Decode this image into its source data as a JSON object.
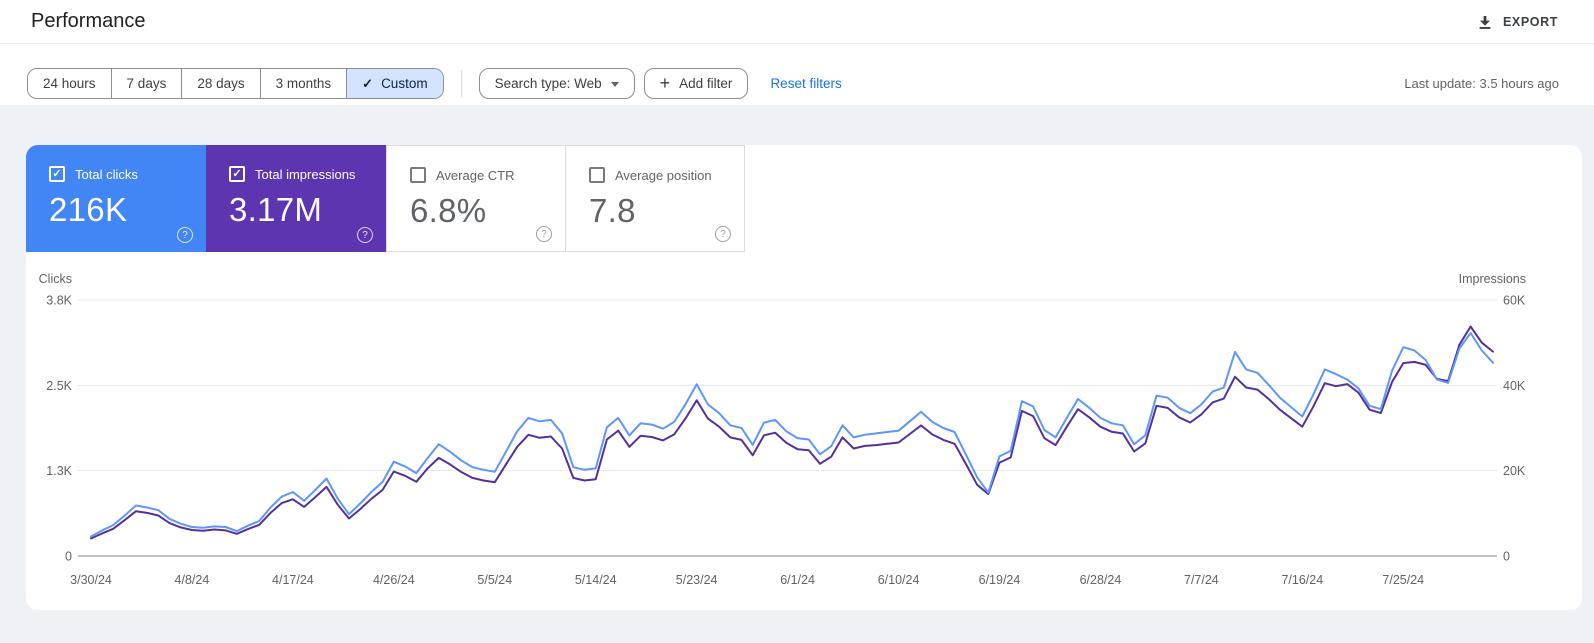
{
  "header": {
    "title": "Performance",
    "export_label": "EXPORT"
  },
  "icons": {
    "export": "download-icon",
    "search_type": "chevron-down-icon",
    "add_filter": "plus-icon",
    "custom_range": "checkmark-icon",
    "metric_help": "help-circle-icon"
  },
  "filters": {
    "ranges": [
      {
        "label": "24 hours",
        "selected": false
      },
      {
        "label": "7 days",
        "selected": false
      },
      {
        "label": "28 days",
        "selected": false
      },
      {
        "label": "3 months",
        "selected": false
      },
      {
        "label": "Custom",
        "selected": true
      }
    ],
    "search_type": "Search type: Web",
    "add_filter_label": "Add filter",
    "reset_label": "Reset filters",
    "last_update": "Last update: 3.5 hours ago"
  },
  "metrics": [
    {
      "id": "total-clicks",
      "label": "Total clicks",
      "value": "216K",
      "selected": true,
      "color": "#4285f4"
    },
    {
      "id": "total-impressions",
      "label": "Total impressions",
      "value": "3.17M",
      "selected": true,
      "color": "#5e35b1"
    },
    {
      "id": "average-ctr",
      "label": "Average CTR",
      "value": "6.8%",
      "selected": false,
      "color": "#ffffff"
    },
    {
      "id": "average-position",
      "label": "Average position",
      "value": "7.8",
      "selected": false,
      "color": "#ffffff"
    }
  ],
  "colors": {
    "clicks_line": "#5e97f6",
    "impressions_line": "#53309e",
    "grid": "#e8eaed",
    "axis_line": "#80868b",
    "selected_chip": "#d3e3fd",
    "link": "#1a73e8",
    "page_background": "#eef1f6"
  },
  "chart_data": {
    "type": "line",
    "title": "Clicks and impressions per day",
    "grid": true,
    "legend": "none",
    "x_axis": {
      "unit": "day",
      "tick_labels": [
        "3/30/24",
        "4/8/24",
        "4/17/24",
        "4/26/24",
        "5/5/24",
        "5/14/24",
        "5/23/24",
        "6/1/24",
        "6/10/24",
        "6/19/24",
        "6/28/24",
        "7/7/24",
        "7/16/24",
        "7/25/24"
      ],
      "tick_indices": [
        0,
        9,
        18,
        27,
        36,
        45,
        54,
        63,
        72,
        81,
        90,
        99,
        108,
        117
      ]
    },
    "y_left": {
      "label": "Clicks",
      "max": 3800,
      "ticks": [
        0,
        1267,
        2533,
        3800
      ],
      "tick_labels": [
        "0",
        "1.3K",
        "2.5K",
        "3.8K"
      ]
    },
    "y_right": {
      "label": "Impressions",
      "max": 60000,
      "ticks": [
        0,
        20000,
        40000,
        60000
      ],
      "tick_labels": [
        "0",
        "20K",
        "40K",
        "60K"
      ]
    },
    "series": [
      {
        "name": "Total clicks",
        "axis": "left",
        "color": "#5e97f6",
        "values": [
          290,
          380,
          460,
          600,
          750,
          720,
          680,
          550,
          480,
          430,
          420,
          440,
          430,
          370,
          450,
          520,
          720,
          880,
          950,
          820,
          980,
          1150,
          850,
          620,
          780,
          950,
          1100,
          1400,
          1330,
          1230,
          1450,
          1660,
          1550,
          1420,
          1320,
          1280,
          1250,
          1550,
          1850,
          2050,
          2000,
          2020,
          1820,
          1320,
          1280,
          1300,
          1910,
          2050,
          1790,
          1970,
          1950,
          1890,
          1990,
          2250,
          2550,
          2250,
          2120,
          1940,
          1900,
          1650,
          1980,
          2020,
          1850,
          1750,
          1730,
          1510,
          1630,
          1940,
          1760,
          1800,
          1820,
          1840,
          1860,
          2000,
          2140,
          1990,
          1900,
          1840,
          1510,
          1170,
          940,
          1480,
          1560,
          2300,
          2220,
          1870,
          1760,
          2050,
          2330,
          2200,
          2050,
          1970,
          1940,
          1660,
          1790,
          2380,
          2350,
          2200,
          2120,
          2250,
          2440,
          2500,
          3030,
          2770,
          2720,
          2540,
          2350,
          2210,
          2070,
          2400,
          2770,
          2700,
          2620,
          2490,
          2230,
          2180,
          2750,
          3100,
          3050,
          2910,
          2620,
          2570,
          3080,
          3310,
          3050,
          2870
        ]
      },
      {
        "name": "Total impressions",
        "axis": "right",
        "color": "#53309e",
        "values": [
          4100,
          5300,
          6400,
          8400,
          10500,
          10100,
          9500,
          7700,
          6700,
          6100,
          5900,
          6200,
          6000,
          5200,
          6300,
          7300,
          10100,
          12400,
          13300,
          11500,
          13800,
          16200,
          12000,
          8800,
          11000,
          13400,
          15500,
          19800,
          18800,
          17400,
          20500,
          23000,
          21500,
          19700,
          18300,
          17700,
          17300,
          21500,
          25600,
          28400,
          27700,
          28000,
          25200,
          18300,
          17700,
          18000,
          27300,
          29400,
          25600,
          28200,
          27900,
          27100,
          28500,
          32200,
          36500,
          32200,
          30300,
          27800,
          27200,
          23600,
          28300,
          28900,
          26500,
          25000,
          24800,
          21600,
          23300,
          27800,
          25200,
          25800,
          26000,
          26300,
          26600,
          28600,
          30600,
          28500,
          27200,
          26300,
          21600,
          16700,
          14500,
          21900,
          23100,
          34000,
          32800,
          27600,
          26000,
          30300,
          34400,
          32500,
          30300,
          29100,
          28700,
          24500,
          26400,
          35200,
          34700,
          32500,
          31300,
          33200,
          36000,
          36900,
          42000,
          39500,
          39000,
          36800,
          34300,
          32300,
          30300,
          35100,
          40500,
          39800,
          40300,
          38300,
          34300,
          33500,
          40800,
          45200,
          45500,
          44800,
          41500,
          41000,
          49500,
          53800,
          50000,
          47900
        ]
      }
    ]
  }
}
